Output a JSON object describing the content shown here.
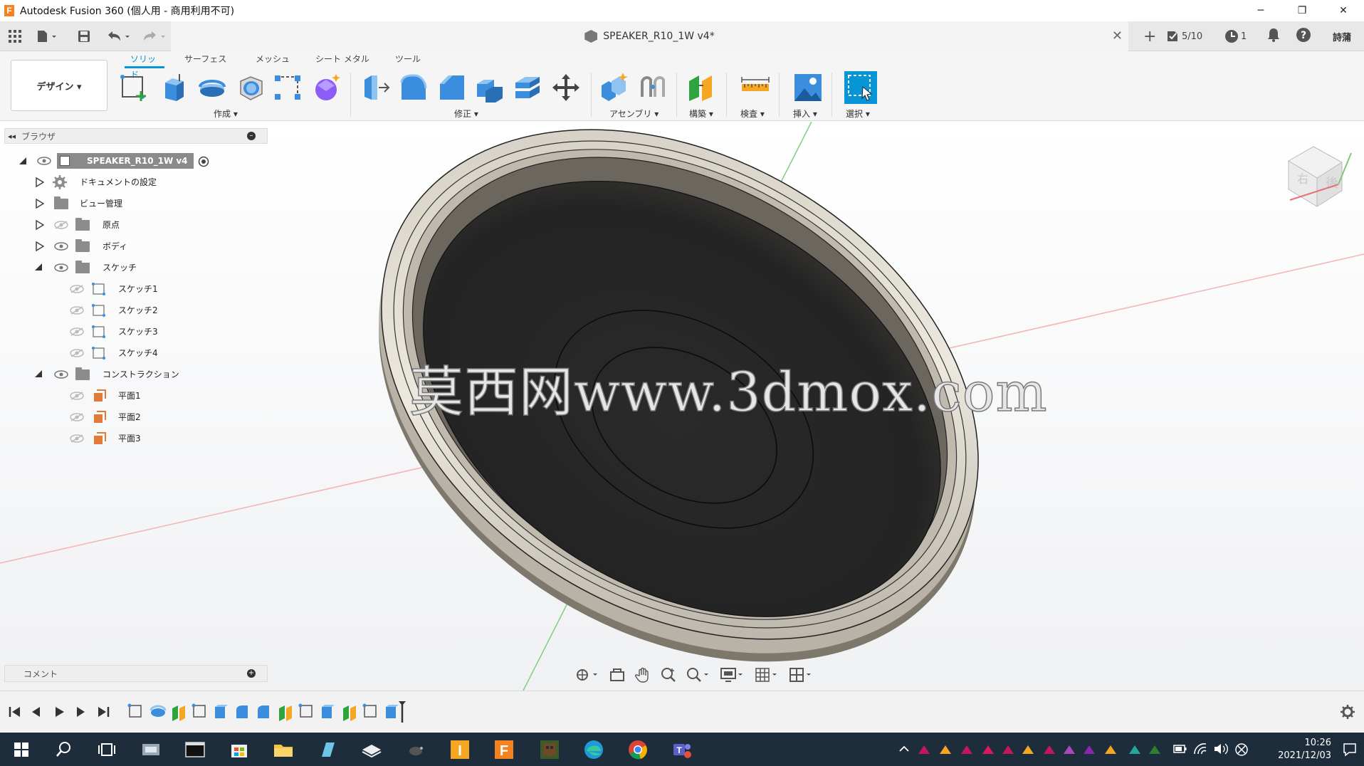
{
  "window": {
    "title": "Autodesk Fusion 360 (個人用 - 商用利用不可)",
    "minimize": "─",
    "restore": "❐",
    "close": "✕"
  },
  "doc_tab": {
    "title": "SPEAKER_R10_1W v4*",
    "close": "✕"
  },
  "qbar_right": {
    "add": "+",
    "job_status": "5/10",
    "clock_count": "1",
    "user": "詩蒲"
  },
  "design_button": "デザイン ▾",
  "ribbon_tabs": [
    {
      "label": "ソリッド",
      "active": true
    },
    {
      "label": "サーフェス",
      "active": false
    },
    {
      "label": "メッシュ",
      "active": false
    },
    {
      "label": "シート メタル",
      "active": false
    },
    {
      "label": "ツール",
      "active": false
    }
  ],
  "ribbon_groups": {
    "create": "作成 ▾",
    "modify": "修正 ▾",
    "assemble": "アセンブリ ▾",
    "construct": "構築 ▾",
    "inspect": "検査 ▾",
    "insert": "挿入 ▾",
    "select": "選択 ▾"
  },
  "browser": {
    "header": "ブラウザ",
    "root": "SPEAKER_R10_1W v4",
    "items": [
      {
        "label": "ドキュメントの設定"
      },
      {
        "label": "ビュー管理"
      },
      {
        "label": "原点"
      },
      {
        "label": "ボディ"
      },
      {
        "label": "スケッチ"
      },
      {
        "label": "スケッチ1"
      },
      {
        "label": "スケッチ2"
      },
      {
        "label": "スケッチ3"
      },
      {
        "label": "スケッチ4"
      },
      {
        "label": "コンストラクション"
      },
      {
        "label": "平面1"
      },
      {
        "label": "平面2"
      },
      {
        "label": "平面3"
      }
    ]
  },
  "viewcube": {
    "face_label": "後",
    "side_label": "右"
  },
  "watermark": "莫西网www.3dmox.com",
  "comment_bar": "コメント",
  "taskbar": {
    "time": "10:26",
    "date": "2021/12/03"
  },
  "colors": {
    "accent": "#0696d7",
    "tool_blue": "#3b8ede",
    "taskbar_bg": "#1e2d3b",
    "fusion_orange": "#f58220"
  },
  "icons": {
    "grid_menu": "grid-icon",
    "file": "file-icon",
    "save": "save-icon",
    "undo": "undo-icon",
    "redo": "redo-icon",
    "notification": "bell-icon",
    "help": "help-icon",
    "settings": "gear-icon"
  }
}
